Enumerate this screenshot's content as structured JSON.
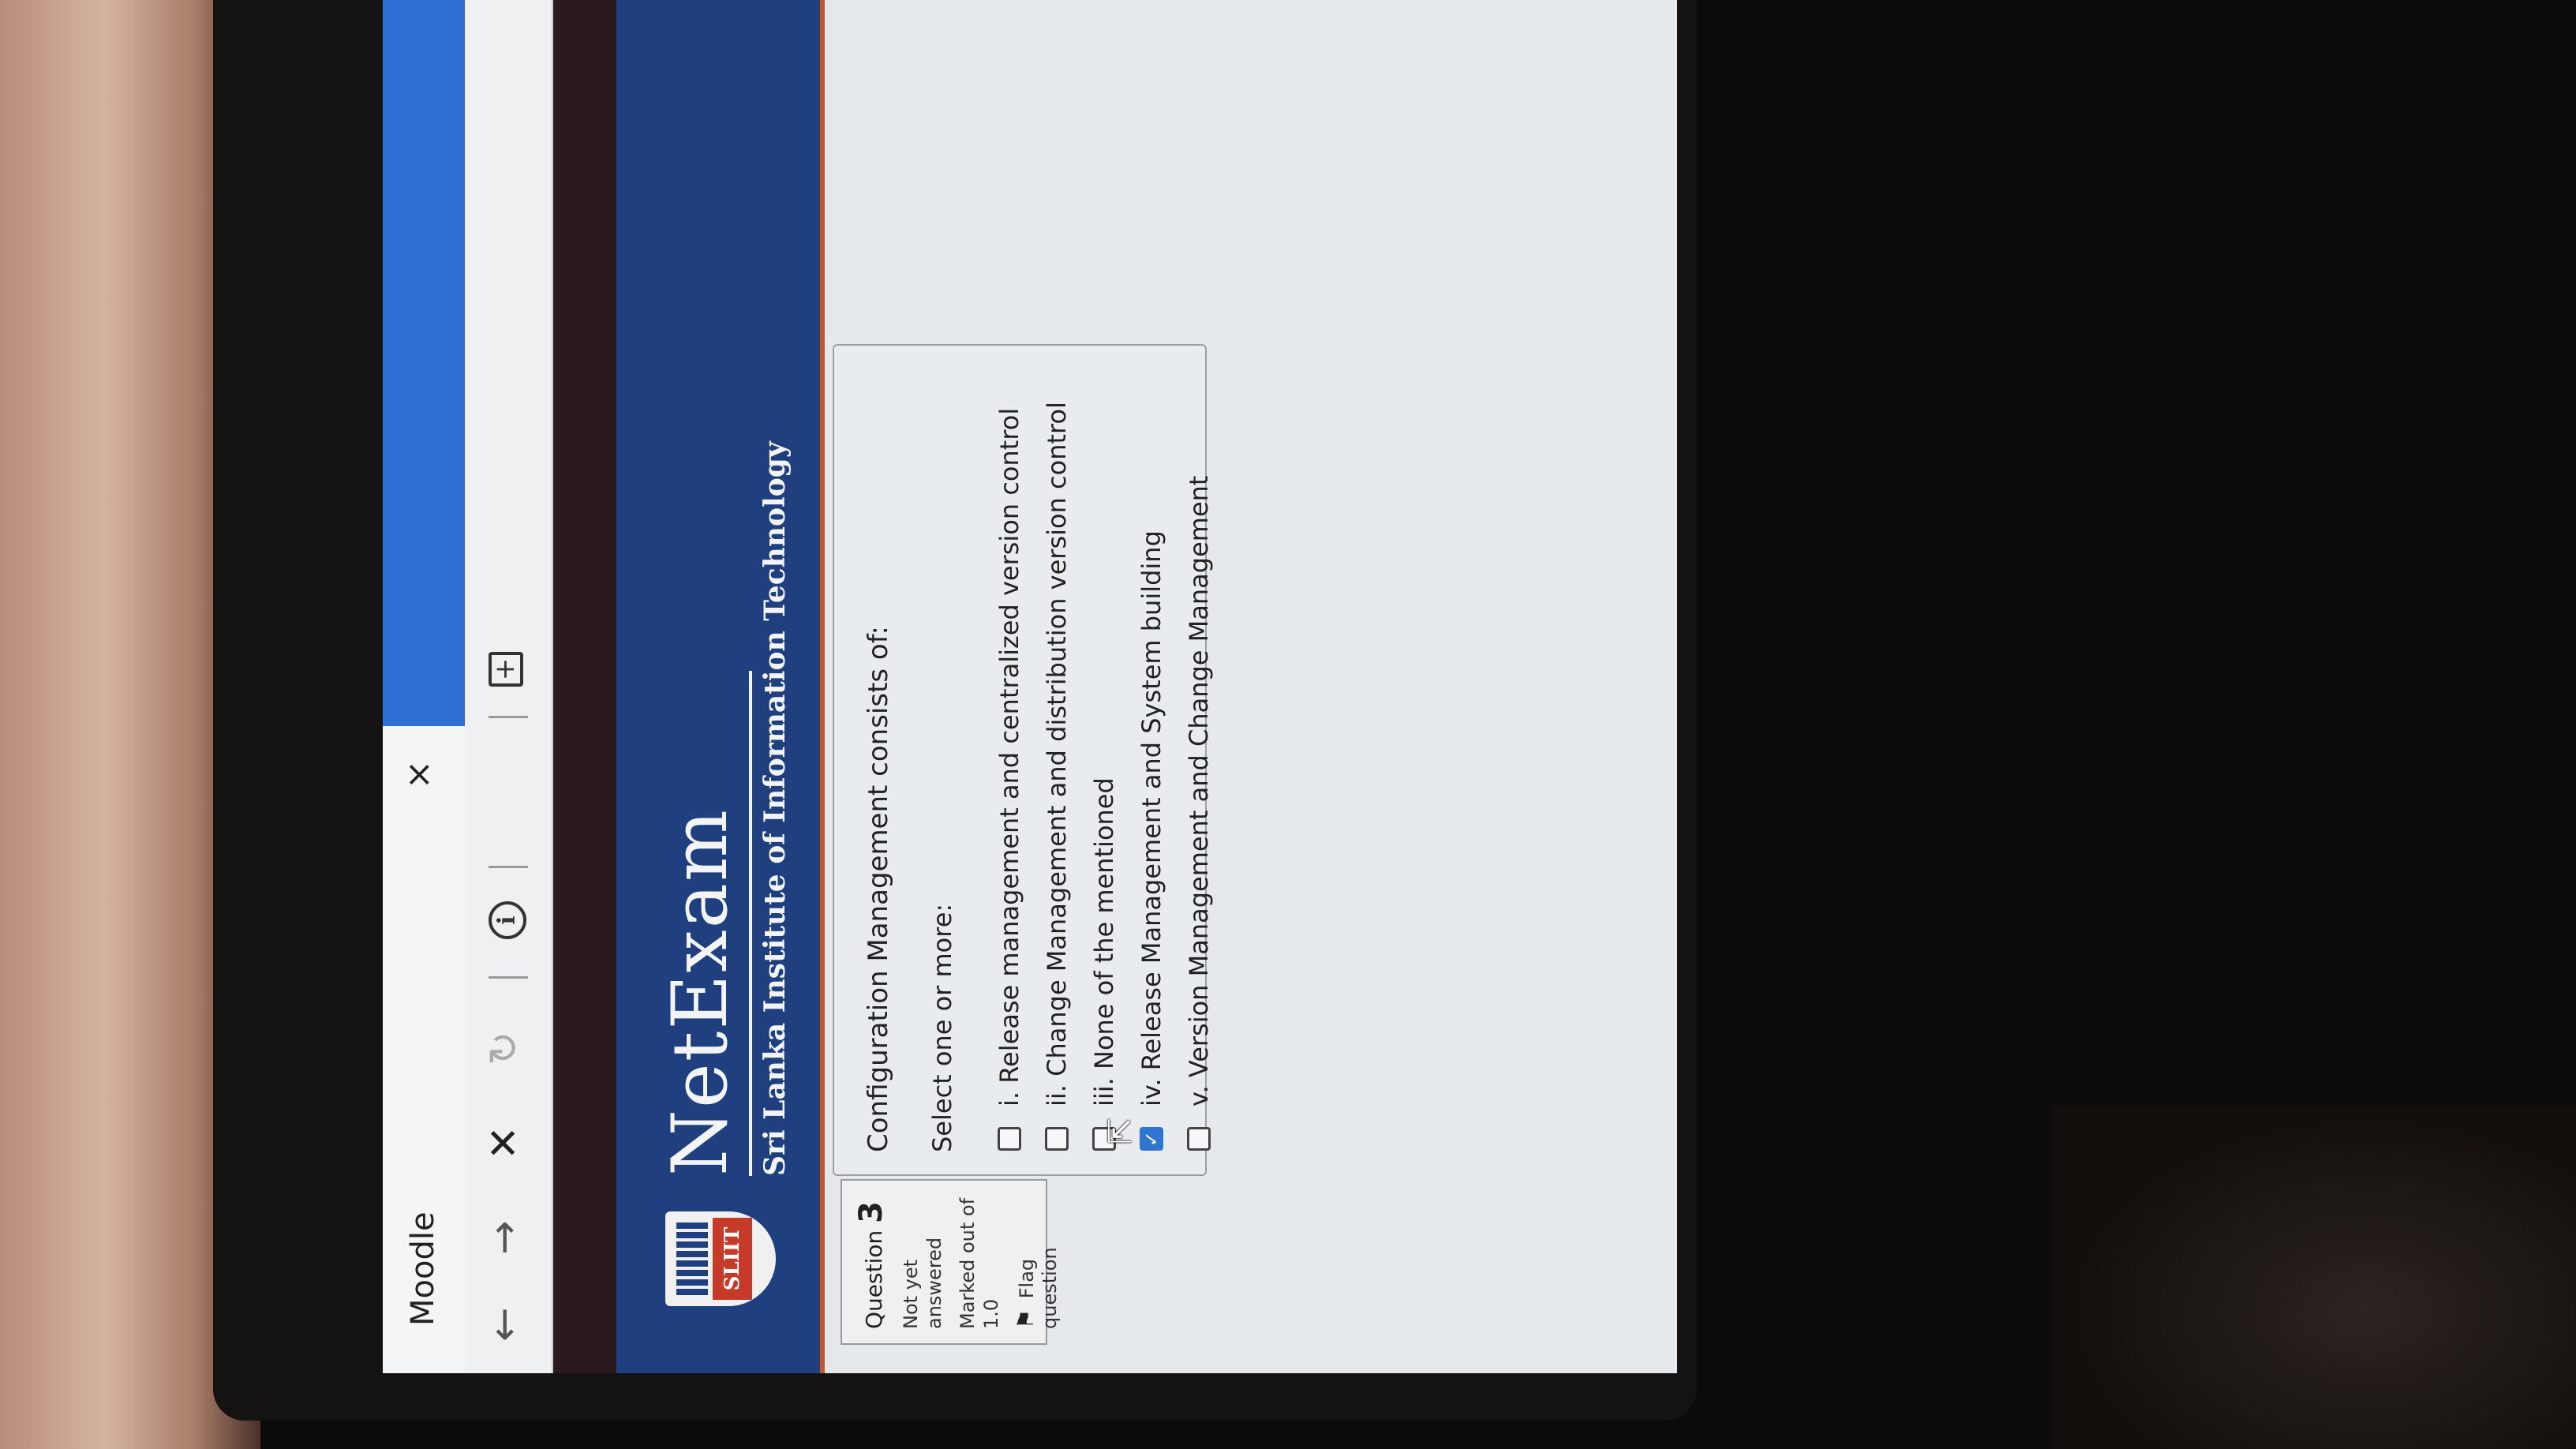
{
  "browser": {
    "tab_title": "Moodle",
    "tab_close_glyph": "×",
    "nav": {
      "back_glyph": "←",
      "forward_glyph": "→",
      "stop_glyph": "✕",
      "reload_glyph": "↻",
      "info_glyph": "i",
      "add_glyph": "+"
    }
  },
  "banner": {
    "logo_text": "SLIIT",
    "brand": "NetExam",
    "subtitle": "Sri Lanka Institute of Information Technology"
  },
  "question_info": {
    "label": "Question",
    "number": "3",
    "state": "Not yet answered",
    "marks": "Marked out of 1.0",
    "flag_glyph": "⚑",
    "flag_label": "Flag question"
  },
  "question": {
    "text": "Configuration Management consists of:",
    "prompt": "Select one or more:",
    "options": [
      {
        "label": "i. Release management and centralized version control",
        "checked": false
      },
      {
        "label": "ii. Change Management and distribution version control",
        "checked": false
      },
      {
        "label": "iii. None of the mentioned",
        "checked": false
      },
      {
        "label": "iv. Release Management and System building",
        "checked": true
      },
      {
        "label": "v. Version Management and Change Management",
        "checked": false
      }
    ],
    "check_glyph": "✓"
  },
  "cursor_glyph": "⇱",
  "colors": {
    "banner": "#1f3f7e",
    "banner_accent": "#c2582b",
    "tab_accent": "#2f6fd3",
    "checkbox_checked": "#2f74d0"
  }
}
